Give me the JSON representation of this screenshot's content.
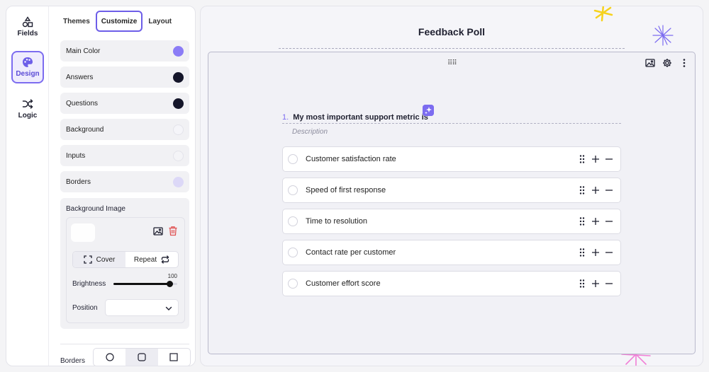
{
  "rail": {
    "items": [
      {
        "label": "Fields",
        "icon": "shapes-icon"
      },
      {
        "label": "Design",
        "icon": "palette-icon",
        "active": true
      },
      {
        "label": "Logic",
        "icon": "shuffle-icon"
      }
    ]
  },
  "tabs": [
    {
      "label": "Themes"
    },
    {
      "label": "Customize",
      "active": true
    },
    {
      "label": "Layout"
    }
  ],
  "customize": {
    "rows": [
      {
        "label": "Main Color",
        "color": "#8b7cf6"
      },
      {
        "label": "Answers",
        "color": "#15162a"
      },
      {
        "label": "Questions",
        "color": "#15162a"
      },
      {
        "label": "Background",
        "color": "#f5f5f9"
      },
      {
        "label": "Inputs",
        "color": "#f4f4f7"
      },
      {
        "label": "Borders",
        "color": "#dcd8f7"
      }
    ],
    "background_image": {
      "title": "Background Image",
      "fit_options": {
        "cover": "Cover",
        "repeat": "Repeat"
      },
      "selected_fit": "Cover",
      "brightness_label": "Brightness",
      "brightness_value": "100",
      "brightness_fraction": 0.88,
      "position_label": "Position",
      "position_value": ""
    },
    "borders_label": "Borders",
    "borders_options": [
      "round",
      "rounded",
      "square"
    ],
    "borders_selected": "rounded"
  },
  "canvas": {
    "title": "Feedback Poll",
    "question_number": "1.",
    "question_text": "My most important support metric is",
    "description_placeholder": "Description",
    "answers": [
      "Customer satisfaction rate",
      "Speed of first response",
      "Time to resolution",
      "Contact rate per customer",
      "Customer effort score"
    ]
  }
}
